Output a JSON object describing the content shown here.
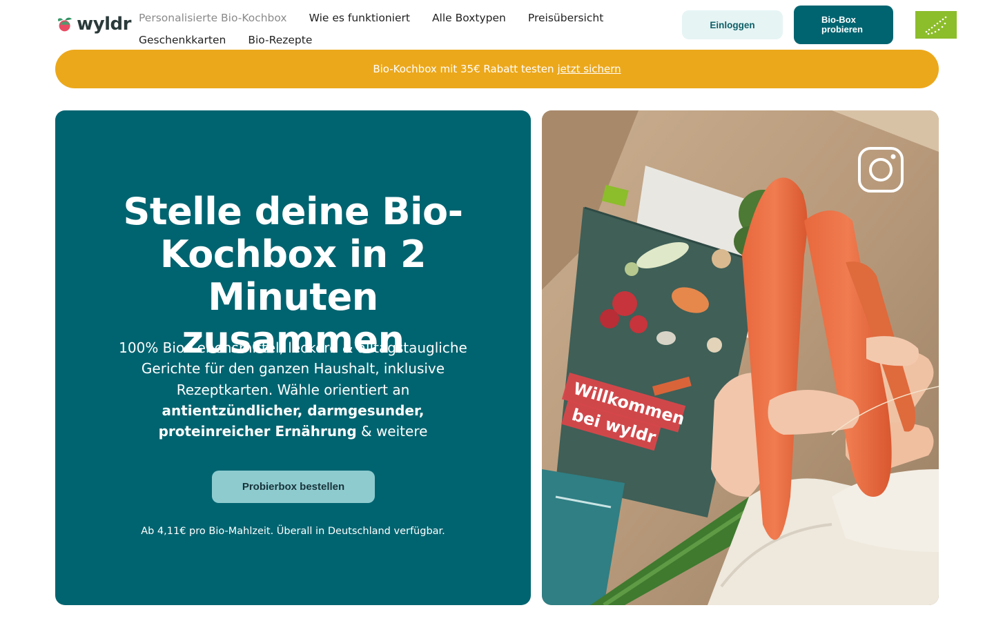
{
  "brand": {
    "name": "wyldr",
    "colors": {
      "primary": "#006470",
      "accent": "#eca81b",
      "light": "#e6f4f4",
      "button_soft": "#8ecbcf",
      "eu_green": "#8cbd2b"
    }
  },
  "header": {
    "nav": {
      "row1": [
        {
          "label": "Personalisierte Bio-Kochbox",
          "active": true
        },
        {
          "label": "Wie es funktioniert"
        },
        {
          "label": "Alle Boxtypen"
        },
        {
          "label": "Preisübersicht"
        }
      ],
      "row2": [
        {
          "label": "Geschenkkarten"
        },
        {
          "label": "Bio-Rezepte"
        }
      ]
    },
    "login_label": "Einloggen",
    "try_label_line1": "Bio-Box",
    "try_label_line2": "probieren",
    "eu_logo_icon": "eu-organic-leaf-logo"
  },
  "promo": {
    "text": "Bio-Kochbox mit 35€ Rabatt testen",
    "link": "jetzt sichern"
  },
  "hero": {
    "title": "Stelle deine Bio-Kochbox in 2 Minuten zusammen",
    "text_plain": "100% Bio-Lebensmittel, leckere & alltagstaugliche Gerichte für den ganzen Haushalt, inklusive Rezeptkarten. Wähle orientiert an",
    "text_bold": "antientzündlicher, darmgesunder, proteinreicher Ernährung",
    "text_tail": "& weitere",
    "cta_label": "Probierbox bestellen",
    "note": "Ab 4,11€ pro Bio-Mahlzeit. Überall in Deutschland verfügbar."
  },
  "media": {
    "card_title_line1": "Willkommen",
    "card_title_line2": "bei wyldr",
    "overlay_icon": "instagram-icon"
  }
}
